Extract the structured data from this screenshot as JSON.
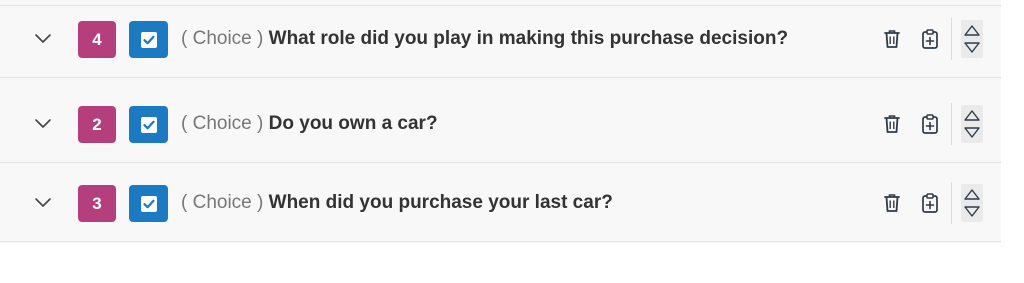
{
  "colors": {
    "number_badge": "#b43f7c",
    "type_badge": "#1b7ac2",
    "icon": "#2f3b48",
    "question_type": "#777777",
    "question_text": "#333333"
  },
  "questions": [
    {
      "number": "2",
      "type_label": "( Choice )",
      "text": "Do you own a car?",
      "type_icon": "checkbox-icon"
    },
    {
      "number": "3",
      "type_label": "( Choice )",
      "text": "When did you purchase your last car?",
      "type_icon": "checkbox-icon"
    },
    {
      "number": "4",
      "type_label": "( Choice )",
      "text": "What role did you play in making this purchase decision?",
      "type_icon": "checkbox-icon"
    }
  ],
  "row_icons": {
    "expand": "chevron-down-icon",
    "delete": "trash-icon",
    "duplicate": "clipboard-plus-icon",
    "move_up": "triangle-up-icon",
    "move_down": "triangle-down-icon"
  }
}
